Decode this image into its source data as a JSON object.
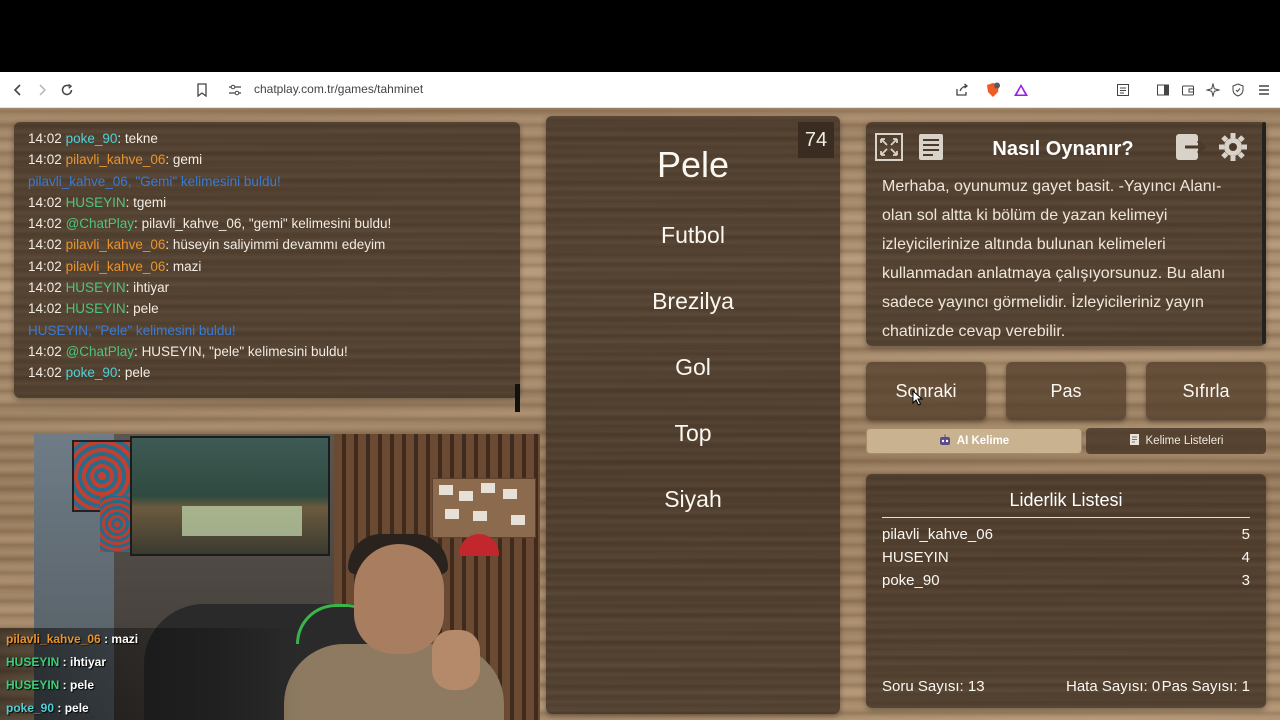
{
  "browser": {
    "url": "chatplay.com.tr/games/tahminet"
  },
  "chat": {
    "lines": [
      {
        "time": "14:02",
        "user": "poke_90",
        "user_color": "cyan",
        "sep": ": ",
        "msg": "tekne"
      },
      {
        "time": "14:02",
        "user": "pilavli_kahve_06",
        "user_color": "orange",
        "sep": ": ",
        "msg": "gemi"
      },
      {
        "system": "pilavli_kahve_06, \"Gemi\" kelimesini buldu!"
      },
      {
        "time": "14:02",
        "user": "HUSEYIN",
        "user_color": "green",
        "sep": ": ",
        "msg": "tgemi"
      },
      {
        "time": "14:02",
        "user": "@ChatPlay",
        "user_color": "green",
        "sep": ": ",
        "msg": "pilavli_kahve_06, \"gemi\" kelimesini buldu!"
      },
      {
        "time": "14:02",
        "user": "pilavli_kahve_06",
        "user_color": "orange",
        "sep": ": ",
        "msg": "hüseyin saliyimmi devammı edeyim"
      },
      {
        "time": "14:02",
        "user": "pilavli_kahve_06",
        "user_color": "orange",
        "sep": ": ",
        "msg": "mazi"
      },
      {
        "time": "14:02",
        "user": "HUSEYIN",
        "user_color": "green",
        "sep": ": ",
        "msg": "ihtiyar"
      },
      {
        "time": "14:02",
        "user": "HUSEYIN",
        "user_color": "green",
        "sep": ": ",
        "msg": "pele"
      },
      {
        "system": "HUSEYIN, \"Pele\" kelimesini buldu!"
      },
      {
        "time": "14:02",
        "user": "@ChatPlay",
        "user_color": "green",
        "sep": ": ",
        "msg": "HUSEYIN, \"pele\" kelimesini buldu!"
      },
      {
        "time": "14:02",
        "user": "poke_90",
        "user_color": "cyan",
        "sep": ": ",
        "msg": "pele"
      }
    ]
  },
  "overlay_chat": [
    {
      "user": "pilavli_kahve_06",
      "color": "#e8932e",
      "sep": " : ",
      "msg": "mazi"
    },
    {
      "user": "HUSEYIN",
      "color": "#39d07a",
      "sep": " : ",
      "msg": "ihtiyar"
    },
    {
      "user": "HUSEYIN",
      "color": "#39d07a",
      "sep": " : ",
      "msg": "pele"
    },
    {
      "user": "poke_90",
      "color": "#4fd0d6",
      "sep": " : ",
      "msg": "pele"
    }
  ],
  "game": {
    "timer": "74",
    "main_word": "Pele",
    "forbidden_words": [
      "Futbol",
      "Brezilya",
      "Gol",
      "Top",
      "Siyah"
    ]
  },
  "help": {
    "title": "Nasıl Oynanır?",
    "text": "Merhaba, oyunumuz gayet basit. -Yayıncı Alanı- olan sol altta ki bölüm de yazan kelimeyi izleyicilerinize altında bulunan kelimeleri kullanmadan anlatmaya çalışıyorsunuz. Bu alanı sadece yayıncı görmelidir. İzleyicileriniz yayın chatinizde cevap verebilir."
  },
  "actions": {
    "next": "Sonraki",
    "pass": "Pas",
    "reset": "Sıfırla",
    "ai_word": "AI Kelime",
    "word_lists": "Kelime Listeleri"
  },
  "leaderboard": {
    "title": "Liderlik Listesi",
    "rows": [
      {
        "name": "pilavli_kahve_06",
        "score": "5"
      },
      {
        "name": "HUSEYIN",
        "score": "4"
      },
      {
        "name": "poke_90",
        "score": "3"
      }
    ],
    "question_count": "Soru Sayısı: 13",
    "error_count": "Hata Sayısı: 0",
    "pass_count": "Pas Sayısı: 1"
  },
  "colors": {
    "green_user": "#4fc47a",
    "orange_user": "#e8932e",
    "cyan_user": "#4fd0d6",
    "system": "#3a7bd5"
  }
}
